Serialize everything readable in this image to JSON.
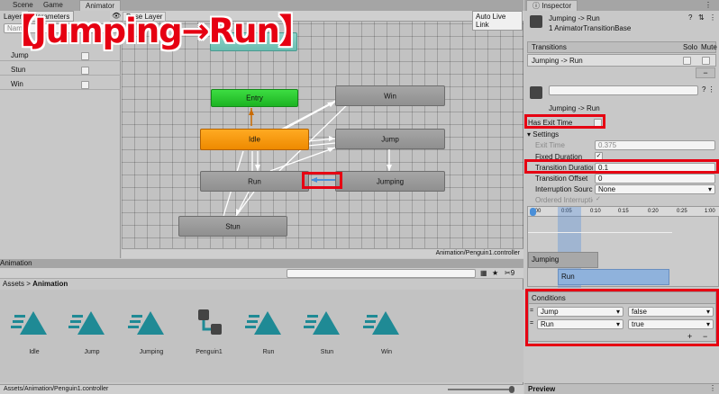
{
  "overlay_title": "【Jumping→Run】",
  "tabs": {
    "scene": "Scene",
    "game": "Game",
    "animator": "Animator",
    "inspector": "Inspector"
  },
  "animator": {
    "layers_tab": "Layers",
    "parameters_tab": "Parameters",
    "search_placeholder": "Name",
    "base_layer": "Base Layer",
    "auto_live_link": "Auto Live Link",
    "footer_path": "Animation/Penguin1.controller",
    "parameters": [
      {
        "name": "Jump"
      },
      {
        "name": "Stun"
      },
      {
        "name": "Win"
      }
    ],
    "states": {
      "entry": "Entry",
      "idle": "Idle",
      "run": "Run",
      "jump": "Jump",
      "jumping": "Jumping",
      "win": "Win",
      "stun": "Stun"
    }
  },
  "project": {
    "title": "Animation",
    "breadcrumb_root": "Assets",
    "breadcrumb_sep": ">",
    "breadcrumb_leaf": "Animation",
    "visibility_count": "9",
    "footer_path": "Assets/Animation/Penguin1.controller",
    "assets": [
      {
        "label": "Idle",
        "icon": "animation-clip-icon"
      },
      {
        "label": "Jump",
        "icon": "animation-clip-icon"
      },
      {
        "label": "Jumping",
        "icon": "animation-clip-icon"
      },
      {
        "label": "Penguin1",
        "icon": "animator-controller-icon"
      },
      {
        "label": "Run",
        "icon": "animation-clip-icon"
      },
      {
        "label": "Stun",
        "icon": "animation-clip-icon"
      },
      {
        "label": "Win",
        "icon": "animation-clip-icon"
      }
    ]
  },
  "inspector": {
    "header_title": "Jumping -> Run",
    "header_subtitle": "1 AnimatorTransitionBase",
    "transitions_label": "Transitions",
    "solo_label": "Solo",
    "mute_label": "Mute",
    "transition_item": "Jumping -> Run",
    "transition_name": "Jumping -> Run",
    "has_exit_time_label": "Has Exit Time",
    "settings_label": "Settings",
    "fields": {
      "exit_time_label": "Exit Time",
      "exit_time_value": "0.375",
      "fixed_duration_label": "Fixed Duration",
      "transition_duration_label": "Transition Duration (s)",
      "transition_duration_value": "0.1",
      "transition_offset_label": "Transition Offset",
      "transition_offset_value": "0",
      "interruption_source_label": "Interruption Source",
      "interruption_source_value": "None",
      "ordered_interruption_label": "Ordered Interruption"
    },
    "timeline_ticks": [
      ":00",
      "0:05",
      "0:10",
      "0:15",
      "0:20",
      "0:25",
      "1:00"
    ],
    "timeline_jumping": "Jumping",
    "timeline_run": "Run",
    "conditions_label": "Conditions",
    "conditions": [
      {
        "param": "Jump",
        "value": "false"
      },
      {
        "param": "Run",
        "value": "true"
      }
    ],
    "preview_label": "Preview"
  },
  "colors": {
    "highlight_red": "#e60012",
    "entry_green": "#22c22a",
    "idle_orange": "#f59a12",
    "clip_teal": "#1f8a95"
  }
}
